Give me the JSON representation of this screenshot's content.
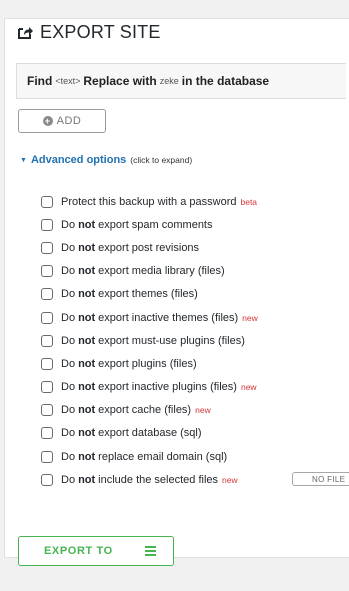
{
  "header": {
    "title": "EXPORT SITE",
    "icon": "export-icon"
  },
  "find_replace": {
    "find_label": "Find",
    "find_value": "<text>",
    "replace_label": "Replace with",
    "replace_value": "zeke",
    "suffix": "in the database"
  },
  "add_button": {
    "label": "ADD",
    "icon": "plus-circle-icon"
  },
  "advanced": {
    "label": "Advanced options",
    "hint": "(click to expand)"
  },
  "options": [
    {
      "pre": "Protect this backup with a password",
      "bold": "",
      "post": "",
      "tag": "beta"
    },
    {
      "pre": "Do",
      "bold": "not",
      "post": "export spam comments",
      "tag": ""
    },
    {
      "pre": "Do",
      "bold": "not",
      "post": "export post revisions",
      "tag": ""
    },
    {
      "pre": "Do",
      "bold": "not",
      "post": "export media library (files)",
      "tag": ""
    },
    {
      "pre": "Do",
      "bold": "not",
      "post": "export themes (files)",
      "tag": ""
    },
    {
      "pre": "Do",
      "bold": "not",
      "post": "export inactive themes (files)",
      "tag": "new"
    },
    {
      "pre": "Do",
      "bold": "not",
      "post": "export must-use plugins (files)",
      "tag": ""
    },
    {
      "pre": "Do",
      "bold": "not",
      "post": "export plugins (files)",
      "tag": ""
    },
    {
      "pre": "Do",
      "bold": "not",
      "post": "export inactive plugins (files)",
      "tag": "new"
    },
    {
      "pre": "Do",
      "bold": "not",
      "post": "export cache (files)",
      "tag": "new"
    },
    {
      "pre": "Do",
      "bold": "not",
      "post": "export database (sql)",
      "tag": ""
    },
    {
      "pre": "Do",
      "bold": "not",
      "post": "replace email domain (sql)",
      "tag": ""
    },
    {
      "pre": "Do",
      "bold": "not",
      "post": "include the selected files",
      "tag": "new"
    }
  ],
  "no_files_button": {
    "label": "NO FILE"
  },
  "export_button": {
    "label": "EXPORT TO",
    "icon": "menu-icon"
  },
  "colors": {
    "accent": "#2271b1",
    "success": "#46b450",
    "tag": "#d63638"
  }
}
